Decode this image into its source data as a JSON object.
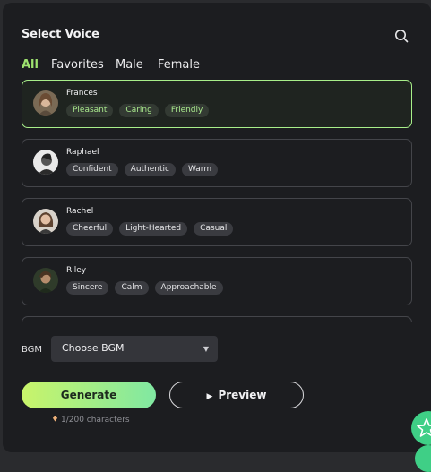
{
  "header": {
    "title": "Select Voice"
  },
  "tabs": [
    {
      "label": "All",
      "active": true
    },
    {
      "label": "Favorites",
      "active": false
    },
    {
      "label": "Male",
      "active": false
    },
    {
      "label": "Female",
      "active": false
    }
  ],
  "voices": [
    {
      "name": "Frances",
      "tags": [
        "Pleasant",
        "Caring",
        "Friendly"
      ],
      "selected": true
    },
    {
      "name": "Raphael",
      "tags": [
        "Confident",
        "Authentic",
        "Warm"
      ],
      "selected": false
    },
    {
      "name": "Rachel",
      "tags": [
        "Cheerful",
        "Light-Hearted",
        "Casual"
      ],
      "selected": false
    },
    {
      "name": "Riley",
      "tags": [
        "Sincere",
        "Calm",
        "Approachable"
      ],
      "selected": false
    }
  ],
  "bgm": {
    "label": "BGM",
    "value": "Choose BGM"
  },
  "actions": {
    "generate": "Generate",
    "preview": "Preview"
  },
  "characters": "1/200 characters",
  "colors": {
    "accent": "#9ee26f",
    "gradient_start": "#c9f46a",
    "gradient_end": "#80e8a2",
    "fab": "#3fcf86"
  }
}
